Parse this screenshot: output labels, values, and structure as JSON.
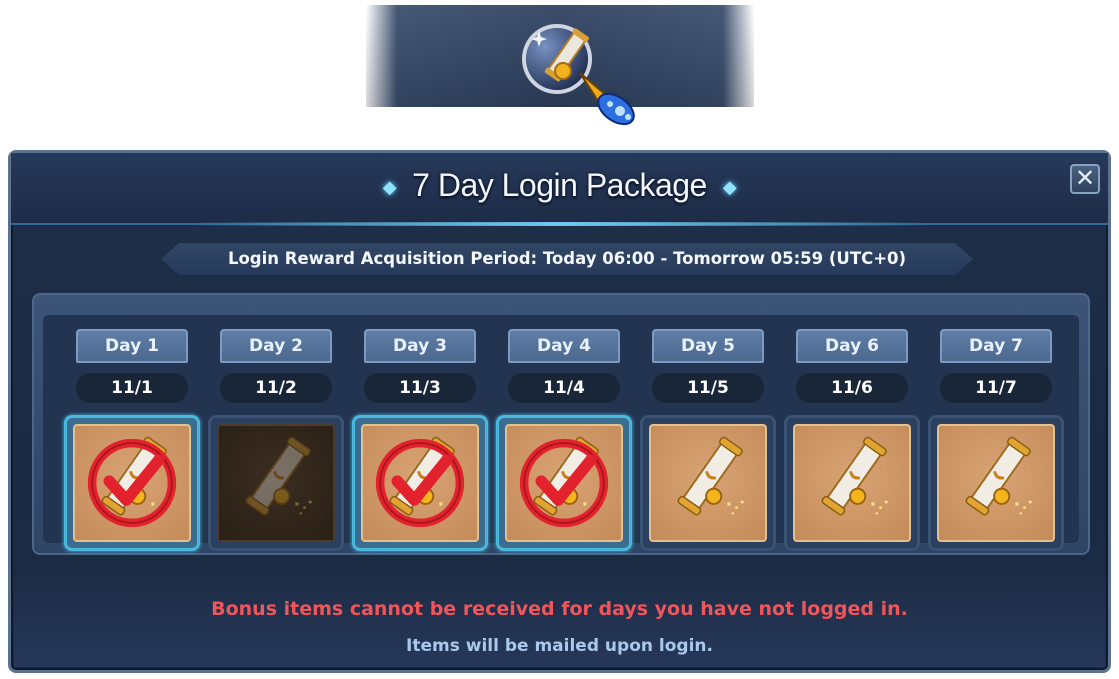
{
  "dialog": {
    "title": "7 Day Login Package",
    "title_ornament": "◆",
    "close_label": "✕",
    "period_text": "Login Reward Acquisition Period: Today 06:00 - Tomorrow 05:59 (UTC+0)",
    "warning_text": "Bonus items cannot be received for days you have not logged in.",
    "info_text": "Items will be mailed upon login."
  },
  "days": [
    {
      "label": "Day 1",
      "date": "11/1",
      "status": "claimed"
    },
    {
      "label": "Day 2",
      "date": "11/2",
      "status": "missed"
    },
    {
      "label": "Day 3",
      "date": "11/3",
      "status": "claimed"
    },
    {
      "label": "Day 4",
      "date": "11/4",
      "status": "claimed"
    },
    {
      "label": "Day 5",
      "date": "11/5",
      "status": "available"
    },
    {
      "label": "Day 6",
      "date": "11/6",
      "status": "available"
    },
    {
      "label": "Day 7",
      "date": "11/7",
      "status": "available"
    }
  ],
  "icons": {
    "event": "scroll-event-icon",
    "cursor": "rocket-cursor-icon",
    "reward": "scroll-reward-icon",
    "claimed": "check-mark-icon"
  },
  "colors": {
    "warning": "#f0555a",
    "info": "#aac8ec",
    "claimed_border": "#49b8dd",
    "checkmark": "#e2222c"
  }
}
